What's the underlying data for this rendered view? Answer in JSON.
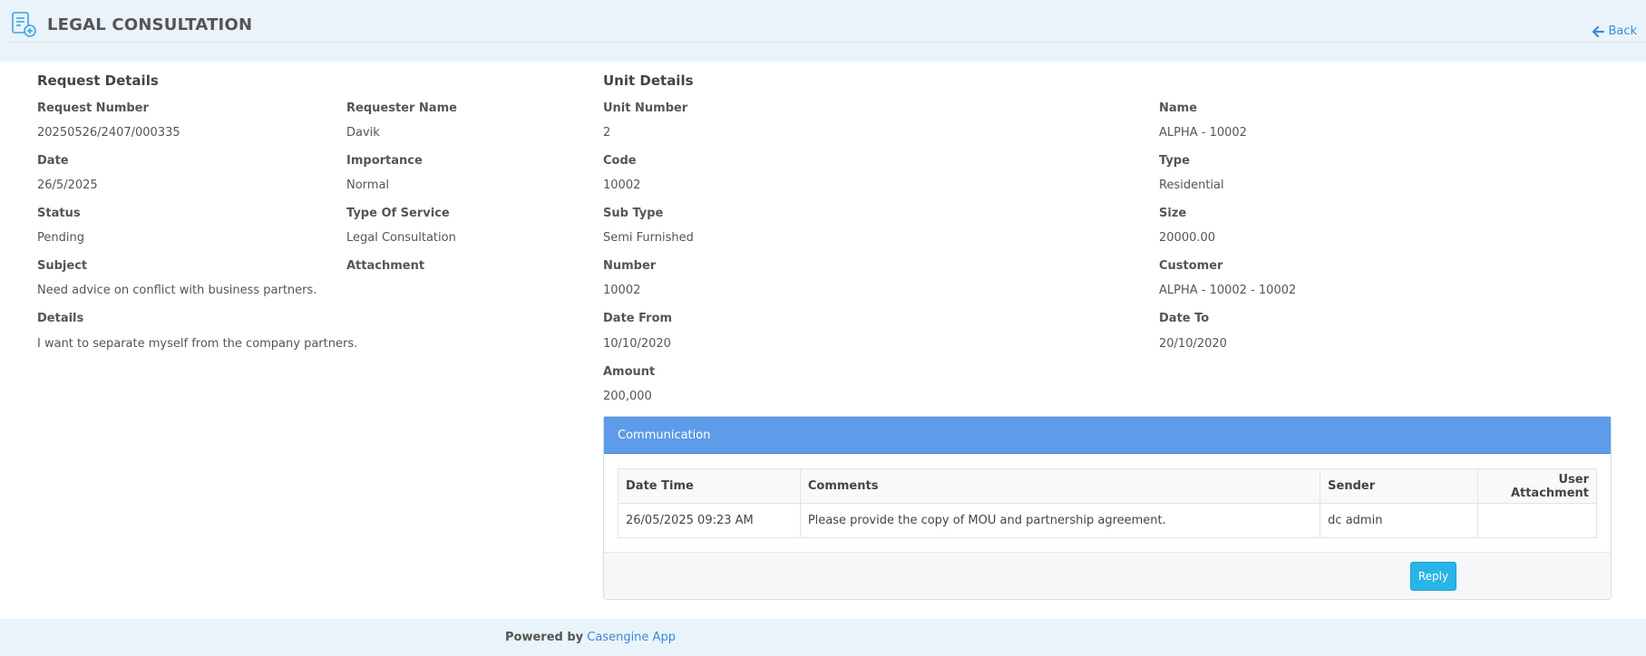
{
  "header": {
    "title": "LEGAL CONSULTATION",
    "icon": "document-add-icon",
    "back_label": "Back",
    "back_icon": "arrow-left-icon"
  },
  "request_details": {
    "title": "Request Details",
    "request_number_label": "Request Number",
    "request_number": "20250526/2407/000335",
    "requester_name_label": "Requester Name",
    "requester_name": "Davik",
    "date_label": "Date",
    "date": "26/5/2025",
    "importance_label": "Importance",
    "importance": "Normal",
    "status_label": "Status",
    "status": "Pending",
    "type_of_service_label": "Type Of Service",
    "type_of_service": "Legal Consultation",
    "subject_label": "Subject",
    "subject": "Need advice on conflict with business partners.",
    "attachment_label": "Attachment",
    "details_label": "Details",
    "details": "I want to separate myself from the company partners."
  },
  "unit_details": {
    "title": "Unit Details",
    "unit_number_label": "Unit Number",
    "unit_number": "2",
    "name_label": "Name",
    "name": "ALPHA - 10002",
    "code_label": "Code",
    "code": "10002",
    "type_label": "Type",
    "type": "Residential",
    "sub_type_label": "Sub Type",
    "sub_type": "Semi Furnished",
    "size_label": "Size",
    "size": "20000.00",
    "number_label": "Number",
    "number": "10002",
    "customer_label": "Customer",
    "customer": "ALPHA - 10002 - 10002",
    "date_from_label": "Date From",
    "date_from": "10/10/2020",
    "date_to_label": "Date To",
    "date_to": "20/10/2020",
    "amount_label": "Amount",
    "amount": "200,000"
  },
  "communication": {
    "title": "Communication",
    "columns": [
      "Date Time",
      "Comments",
      "Sender",
      "User Attachment"
    ],
    "rows": [
      {
        "date_time": "26/05/2025 09:23 AM",
        "comments": "Please provide the copy of MOU and partnership agreement.",
        "sender": "dc admin",
        "user_attachment": ""
      }
    ],
    "reply_label": "Reply"
  },
  "footer": {
    "powered_by": "Powered by",
    "link_text": "Casengine App"
  },
  "colors": {
    "header_bg": "#eaf3f9",
    "panel_head_bg": "#5e9be8",
    "reply_btn_bg": "#28b4e6",
    "link": "#3a8ad8"
  }
}
